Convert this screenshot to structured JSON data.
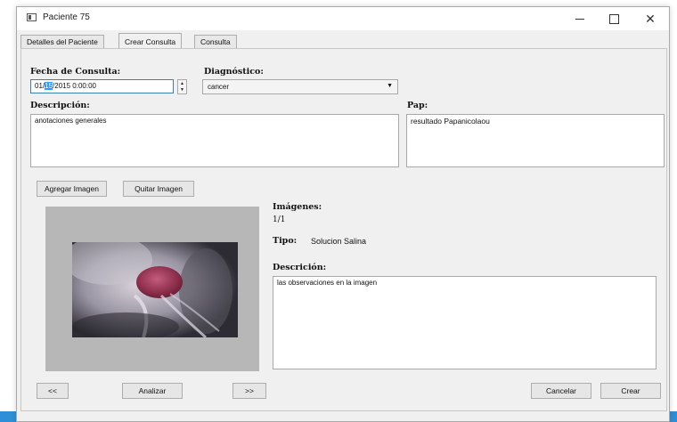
{
  "window": {
    "title": "Paciente 75",
    "controls": {
      "minimize": "—",
      "maximize": "☐",
      "close": "✕"
    }
  },
  "tabs": [
    {
      "label": "Detalles del Paciente"
    },
    {
      "label": "Crear Consulta"
    },
    {
      "label": "Consulta"
    }
  ],
  "form": {
    "fecha": {
      "label": "Fecha de Consulta:",
      "value_pre": "01/",
      "value_sel": "15",
      "value_post": "/2015 0:00:00"
    },
    "diagnostico": {
      "label": "Diagnóstico:",
      "value": "cancer"
    },
    "descripcion": {
      "label": "Descripción:",
      "value": "anotaciones generales"
    },
    "pap": {
      "label": "Pap:",
      "value": "resultado Papanicolaou"
    }
  },
  "image_buttons": {
    "add": "Agregar Imagen",
    "remove": "Quitar Imagen"
  },
  "image_info": {
    "imagenes_label": "Imágenes:",
    "count": "1/1",
    "tipo_label": "Tipo:",
    "tipo_value": "Solucion Salina",
    "descricion_label": "Descrición:",
    "descricion_value": "las observaciones en la imagen"
  },
  "bottom_buttons": {
    "prev": "<<",
    "analizar": "Analizar",
    "next": ">>",
    "cancelar": "Cancelar",
    "crear": "Crear"
  },
  "colors": {
    "accent": "#3399ff",
    "taskbar": "#2e8fd8"
  }
}
